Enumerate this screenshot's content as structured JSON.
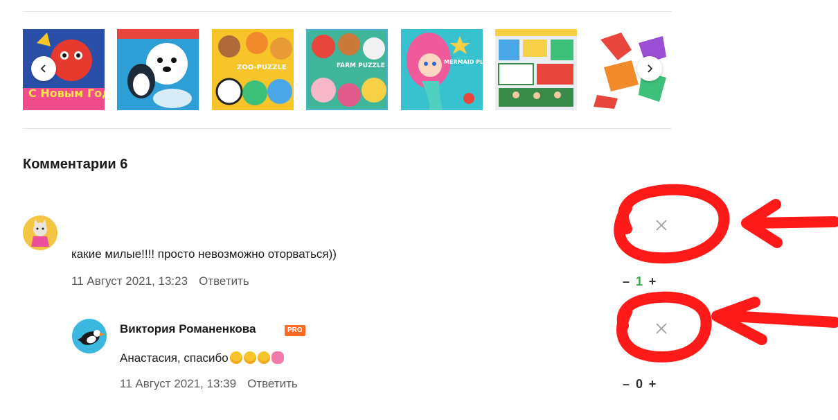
{
  "gallery": {
    "prev_icon": "chevron-left-icon",
    "next_icon": "chevron-right-icon",
    "items": [
      {
        "caption": "С Новым Годом!",
        "bg": "#2a4fa8"
      },
      {
        "caption": "",
        "bg": "#2e9fd6"
      },
      {
        "caption": "ZOO-PUZZLE",
        "bg": "#f7c52a"
      },
      {
        "caption": "FARM PUZZLE",
        "bg": "#3fb59a"
      },
      {
        "caption": "MERMAID PLAY SET",
        "bg": "#38c2cf"
      },
      {
        "caption": "",
        "bg": "#e8eef2"
      },
      {
        "caption": "",
        "bg": "#ffffff"
      }
    ]
  },
  "comments_section": {
    "title": "Комментарии 6"
  },
  "comments": [
    {
      "author": "",
      "text": "какие милые!!!! просто невозможно оторваться))",
      "date": "11 Август 2021, 13:23",
      "reply_label": "Ответить",
      "votes": "1",
      "vote_color": "#3aa84a",
      "avatar_bg": "#f4c542"
    },
    {
      "author": "Виктория Романенкова",
      "badge": "PRO",
      "text": "Анастасия, спасибо",
      "date": "11 Август 2021, 13:39",
      "reply_label": "Ответить",
      "votes": "0",
      "vote_color": "#333333",
      "avatar_bg": "#3bb8e0"
    }
  ],
  "vote_controls": {
    "minus": "–",
    "plus": "+"
  },
  "annotation_color": "#ff1a1a"
}
